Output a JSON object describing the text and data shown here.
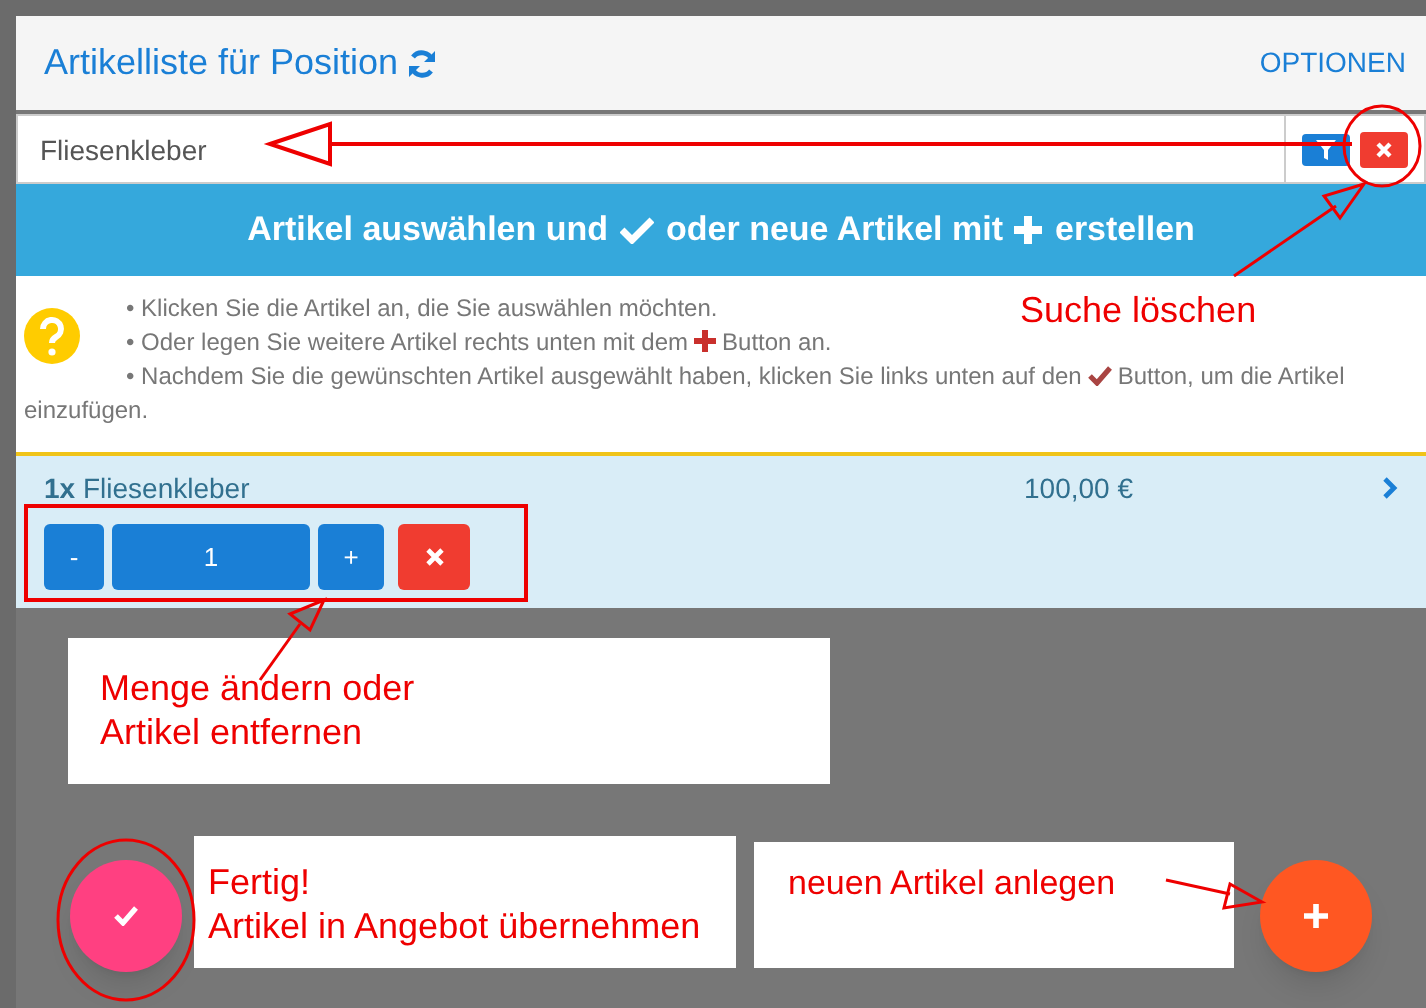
{
  "header": {
    "title": "Artikelliste für Position",
    "options": "OPTIONEN"
  },
  "search": {
    "value": "Fliesenkleber"
  },
  "banner": {
    "text_1": "Artikel auswählen und",
    "text_2": "oder neue Artikel mit",
    "text_3": "erstellen"
  },
  "help": {
    "items": [
      {
        "kind": "plain",
        "bullet": "•",
        "text": "Klicken Sie die Artikel an, die Sie auswählen möchten."
      },
      {
        "kind": "plus",
        "bullet": "•",
        "text": "Oder legen Sie weitere Artikel rechts unten mit dem",
        "after": "Button an."
      },
      {
        "kind": "check",
        "bullet": "•",
        "text": "Nachdem Sie die gewünschten Artikel ausgewählt haben, klicken Sie links unten auf den",
        "after": "Button, um die Artikel einzufügen."
      }
    ]
  },
  "items": [
    {
      "quantity_prefix": "1x",
      "name": "Fliesenkleber",
      "price": "100,00 €",
      "minus": "-",
      "quantity": "1",
      "plus": "+"
    }
  ],
  "annotations": {
    "clear_search": "Suche löschen",
    "quantity_note": "Menge ändern oder\nArtikel entfernen",
    "done_note": "Fertig!\nArtikel in Angebot übernehmen",
    "new_note": "neuen Artikel anlegen"
  }
}
